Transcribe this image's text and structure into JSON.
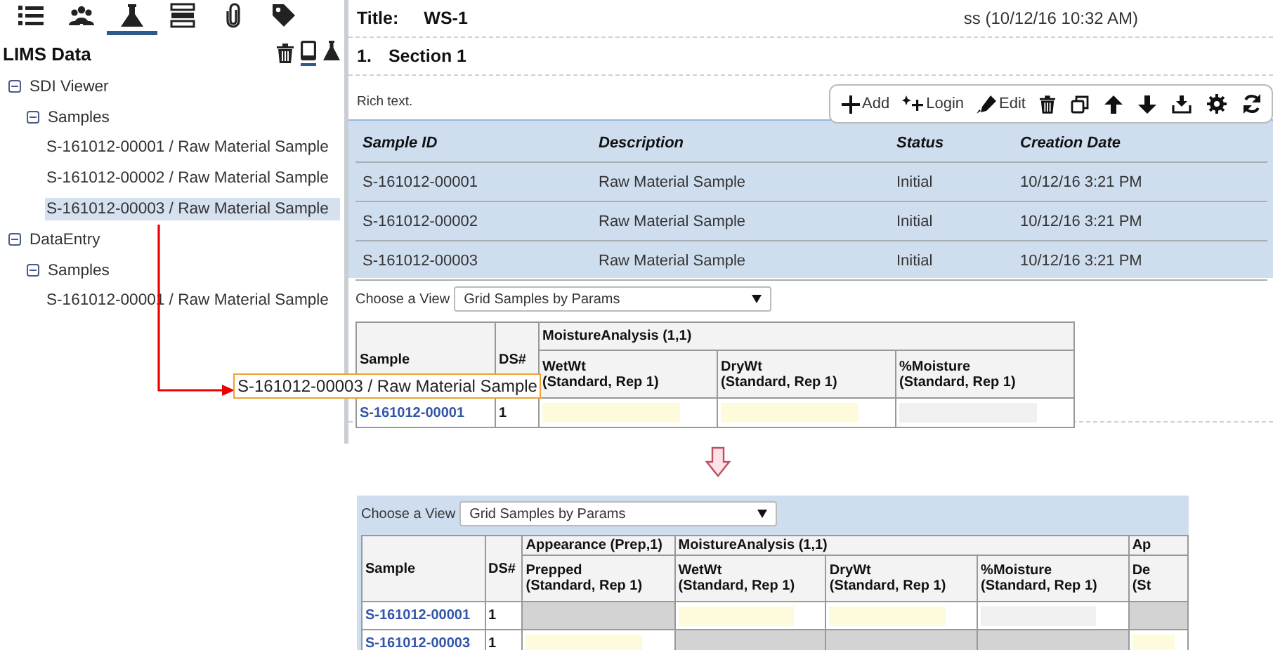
{
  "sidebar": {
    "tabs": [
      {
        "selected": false
      },
      {
        "selected": false
      },
      {
        "selected": true
      },
      {
        "selected": false
      },
      {
        "selected": false
      },
      {
        "selected": false
      }
    ],
    "title": "LIMS Data",
    "view_toggles": [
      {
        "selected": true
      },
      {
        "selected": false
      }
    ],
    "tree": [
      {
        "label": "SDI Viewer",
        "expanded": true,
        "children": [
          {
            "label": "Samples",
            "expanded": true,
            "children": [
              {
                "label": "S-161012-00001 / Raw Material Sample",
                "selected": false
              },
              {
                "label": "S-161012-00002 / Raw Material Sample",
                "selected": false
              },
              {
                "label": "S-161012-00003 / Raw Material Sample",
                "selected": true
              }
            ]
          }
        ]
      },
      {
        "label": "DataEntry",
        "expanded": true,
        "children": [
          {
            "label": "Samples",
            "expanded": true,
            "children": [
              {
                "label": "S-161012-00001 / Raw Material Sample",
                "selected": false
              }
            ]
          }
        ]
      }
    ]
  },
  "drag_tooltip": "S-161012-00003 / Raw Material Sample",
  "document": {
    "title_label": "Title:",
    "title": "WS-1",
    "stamp": "ss (10/12/16 10:32 AM)",
    "section_number": "1.",
    "section_title": "Section 1",
    "rich_text": "Rich text.",
    "toolbar": [
      {
        "label": "Add"
      },
      {
        "label": "Login"
      },
      {
        "label": "Edit"
      }
    ],
    "samples_table": {
      "columns": [
        "Sample ID",
        "Description",
        "Status",
        "Creation Date"
      ],
      "rows": [
        [
          "S-161012-00001",
          "Raw Material Sample",
          "Initial",
          "10/12/16 3:21 PM"
        ],
        [
          "S-161012-00002",
          "Raw Material Sample",
          "Initial",
          "10/12/16 3:21 PM"
        ],
        [
          "S-161012-00003",
          "Raw Material Sample",
          "Initial",
          "10/12/16 3:21 PM"
        ]
      ]
    },
    "grid": {
      "view_label": "Choose a View",
      "view": "Grid Samples by Params",
      "sample_header": "Sample",
      "ds_header": "DS#",
      "groups": [
        {
          "title": "MoistureAnalysis (1,1)",
          "params": [
            {
              "name": "WetWt",
              "detail": "(Standard, Rep 1)"
            },
            {
              "name": "DryWt",
              "detail": "(Standard, Rep 1)"
            },
            {
              "name": "%Moisture",
              "detail": "(Standard, Rep 1)"
            }
          ]
        }
      ],
      "rows": [
        {
          "sample": "S-161012-00001",
          "ds": "1",
          "cells": [
            {
              "kind": "entry"
            },
            {
              "kind": "entry"
            },
            {
              "kind": "calculated"
            }
          ]
        }
      ]
    }
  },
  "result_grid": {
    "view_label": "Choose a View",
    "view": "Grid Samples by Params",
    "sample_header": "Sample",
    "ds_header": "DS#",
    "groups": [
      {
        "title": "Appearance (Prep,1)",
        "params": [
          {
            "name": "Prepped",
            "detail": "(Standard, Rep 1)"
          }
        ]
      },
      {
        "title": "MoistureAnalysis (1,1)",
        "params": [
          {
            "name": "WetWt",
            "detail": "(Standard, Rep 1)"
          },
          {
            "name": "DryWt",
            "detail": "(Standard, Rep 1)"
          },
          {
            "name": "%Moisture",
            "detail": "(Standard, Rep 1)"
          }
        ]
      },
      {
        "title": "Ap",
        "params": [
          {
            "name": "De",
            "detail": "(St"
          }
        ]
      }
    ],
    "rows": [
      {
        "sample": "S-161012-00001",
        "ds": "1",
        "cells": [
          {
            "kind": "na"
          },
          {
            "kind": "entry"
          },
          {
            "kind": "entry"
          },
          {
            "kind": "calculated"
          },
          {
            "kind": "na"
          }
        ]
      },
      {
        "sample": "S-161012-00003",
        "ds": "1",
        "cells": [
          {
            "kind": "entry"
          },
          {
            "kind": "na"
          },
          {
            "kind": "na"
          },
          {
            "kind": "na"
          },
          {
            "kind": "entry"
          }
        ]
      }
    ]
  }
}
